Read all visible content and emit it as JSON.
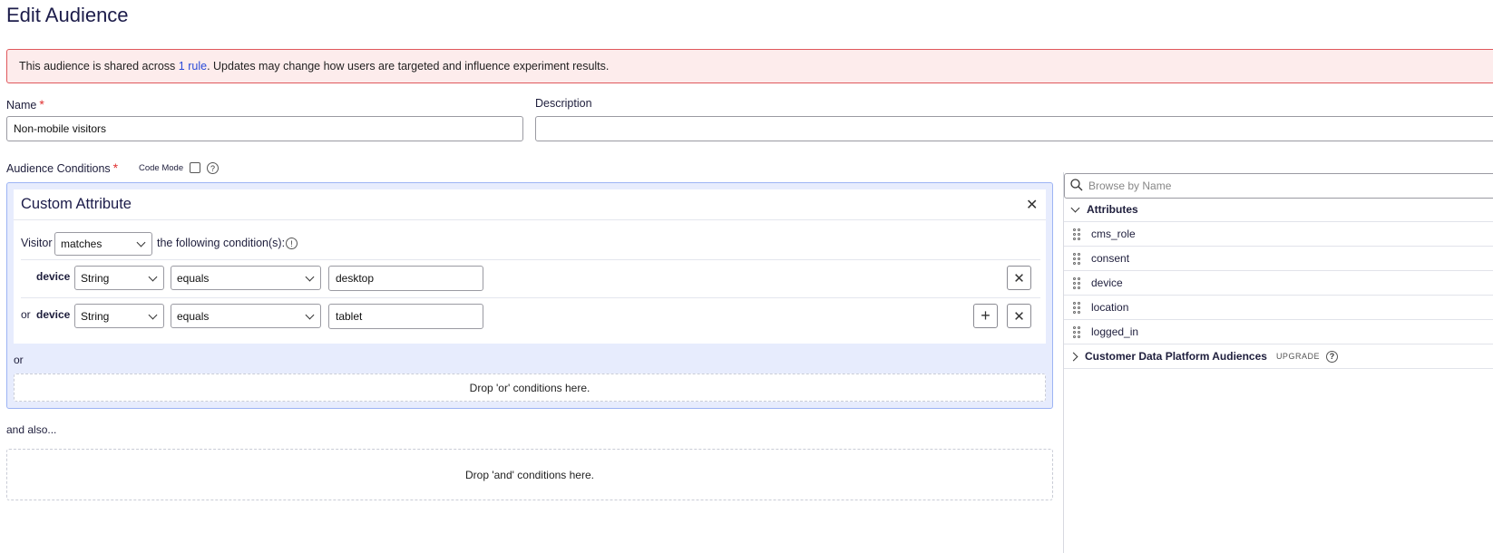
{
  "page": {
    "title": "Edit Audience"
  },
  "banner": {
    "text_before": "This audience is shared across ",
    "link": "1 rule",
    "text_after": ". Updates may change how users are targeted and influence experiment results."
  },
  "form": {
    "name_label": "Name",
    "name_value": "Non-mobile visitors",
    "description_label": "Description",
    "description_value": "",
    "conditions_label": "Audience Conditions",
    "required_mark": "*",
    "code_mode_label": "Code Mode",
    "help_glyph": "?"
  },
  "condition_card": {
    "title": "Custom Attribute",
    "visitor_label": "Visitor",
    "match_value": "matches",
    "match_suffix": "the following condition(s):",
    "info_glyph": "!",
    "rows": [
      {
        "prefix": "",
        "attribute": "device",
        "type": "String",
        "operator": "equals",
        "value": "desktop"
      },
      {
        "prefix": "or",
        "attribute": "device",
        "type": "String",
        "operator": "equals",
        "value": "tablet"
      }
    ]
  },
  "or_label": "or",
  "drop_or": "Drop 'or' conditions here.",
  "and_also": "and also...",
  "drop_and": "Drop 'and' conditions here.",
  "right_panel": {
    "search_placeholder": "Browse by Name",
    "attributes_header": "Attributes",
    "attributes": [
      "cms_role",
      "consent",
      "device",
      "location",
      "logged_in"
    ],
    "cdp_header": "Customer Data Platform Audiences",
    "cdp_badge": "UPGRADE"
  }
}
